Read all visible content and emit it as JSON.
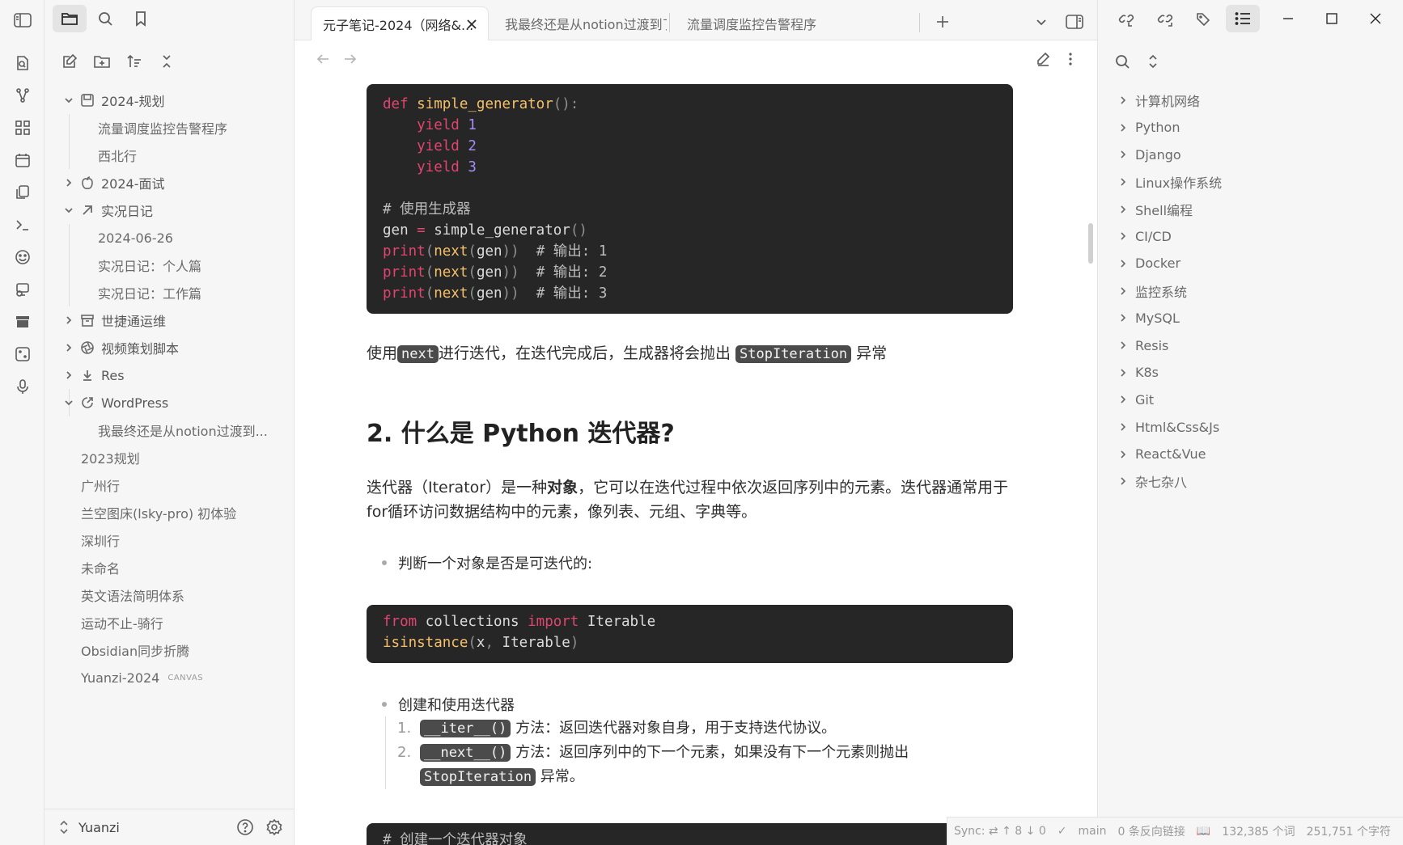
{
  "tabs": [
    {
      "label": "元子笔记-2024（网络&..."
    },
    {
      "label": "我最终还是从notion过渡到了..."
    },
    {
      "label": "流量调度监控告警程序"
    }
  ],
  "file_tree": [
    {
      "label": "2024-规划",
      "type": "folder",
      "expanded": true,
      "icon": "calendar-square-icon"
    },
    {
      "label": "流量调度监控告警程序",
      "type": "file"
    },
    {
      "label": "西北行",
      "type": "file"
    },
    {
      "label": "2024-面试",
      "type": "folder",
      "expanded": false,
      "icon": "apple-icon"
    },
    {
      "label": "实况日记",
      "type": "folder",
      "expanded": true,
      "icon": "arrow-up-right-icon"
    },
    {
      "label": "2024-06-26",
      "type": "file"
    },
    {
      "label": "实况日记：个人篇",
      "type": "file"
    },
    {
      "label": "实况日记：工作篇",
      "type": "file"
    },
    {
      "label": "世捷通运维",
      "type": "folder",
      "expanded": false,
      "icon": "archive-icon"
    },
    {
      "label": "视频策划脚本",
      "type": "folder",
      "expanded": false,
      "icon": "aperture-icon"
    },
    {
      "label": "Res",
      "type": "folder",
      "expanded": false,
      "icon": "download-icon"
    },
    {
      "label": "WordPress",
      "type": "folder",
      "expanded": true,
      "icon": "external-link-icon"
    },
    {
      "label": "我最终还是从notion过渡到...",
      "type": "file"
    },
    {
      "label": "2023规划",
      "type": "root-file"
    },
    {
      "label": "广州行",
      "type": "root-file"
    },
    {
      "label": "兰空图床(lsky-pro) 初体验",
      "type": "root-file"
    },
    {
      "label": "深圳行",
      "type": "root-file"
    },
    {
      "label": "未命名",
      "type": "root-file"
    },
    {
      "label": "英文语法简明体系",
      "type": "root-file"
    },
    {
      "label": "运动不止-骑行",
      "type": "root-file"
    },
    {
      "label": "Obsidian同步折腾",
      "type": "root-file"
    },
    {
      "label": "Yuanzi-2024",
      "type": "root-file",
      "tag": "CANVAS"
    }
  ],
  "vault": {
    "name": "Yuanzi"
  },
  "editor": {
    "code1": [
      "def simple_generator():",
      "    yield 1",
      "    yield 2",
      "    yield 3",
      "",
      "# 使用生成器",
      "gen = simple_generator()",
      "print(next(gen))  # 输出: 1",
      "print(next(gen))  # 输出: 2",
      "print(next(gen))  # 输出: 3"
    ],
    "para1": {
      "pre": "使用",
      "code": "next",
      "mid": "进行迭代，在迭代完成后，生成器将会抛出 ",
      "code2": "StopIteration",
      "post": " 异常"
    },
    "heading": "2. 什么是 Python 迭代器?",
    "para2": {
      "pre": "迭代器（Iterator）是一种",
      "bold": "对象",
      "post": "，它可以在迭代过程中依次返回序列中的元素。迭代器通常用于for循环访问数据结构中的元素，像列表、元组、字典等。"
    },
    "bullet1": "判断一个对象是否是可迭代的:",
    "code2": [
      "from collections import Iterable",
      "isinstance(x, Iterable)"
    ],
    "bullet2": "创建和使用迭代器",
    "ol": [
      {
        "n": "1.",
        "code": "__iter__()",
        "text": " 方法：返回迭代器对象自身，用于支持迭代协议。"
      },
      {
        "n": "2.",
        "code": "__next__()",
        "text": " 方法：返回序列中的下一个元素，如果没有下一个元素则抛出",
        "code2": "StopIteration",
        "text2": " 异常。"
      }
    ],
    "code3_first": "# 创建一个迭代器对象"
  },
  "outline": [
    "计算机网络",
    "Python",
    "Django",
    "Linux操作系统",
    "Shell编程",
    "CI/CD",
    "Docker",
    "监控系统",
    "MySQL",
    "Resis",
    "K8s",
    "Git",
    "Html&Css&Js",
    "React&Vue",
    "杂七杂八"
  ],
  "status": {
    "sync": "Sync:",
    "up": "8",
    "down": "0",
    "branch": "main",
    "backlinks": "0 条反向链接",
    "words": "132,385 个词",
    "chars": "251,751 个字符"
  }
}
